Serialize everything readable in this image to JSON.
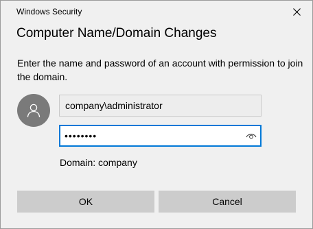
{
  "window": {
    "title": "Windows Security",
    "close_icon": "close-icon"
  },
  "dialog": {
    "heading": "Computer Name/Domain Changes",
    "description": "Enter the name and password of an account with permission to join the domain.",
    "avatar_icon": "user-icon",
    "username_value": "company\\administrator",
    "password_value": "••••••••",
    "reveal_icon": "eye-icon",
    "domain_label": "Domain: company"
  },
  "buttons": {
    "ok_label": "OK",
    "cancel_label": "Cancel"
  },
  "colors": {
    "focus_border": "#0078d7",
    "button_bg": "#cccccc",
    "dialog_bg": "#f0f0f0",
    "avatar_bg": "#7a7a7a"
  }
}
